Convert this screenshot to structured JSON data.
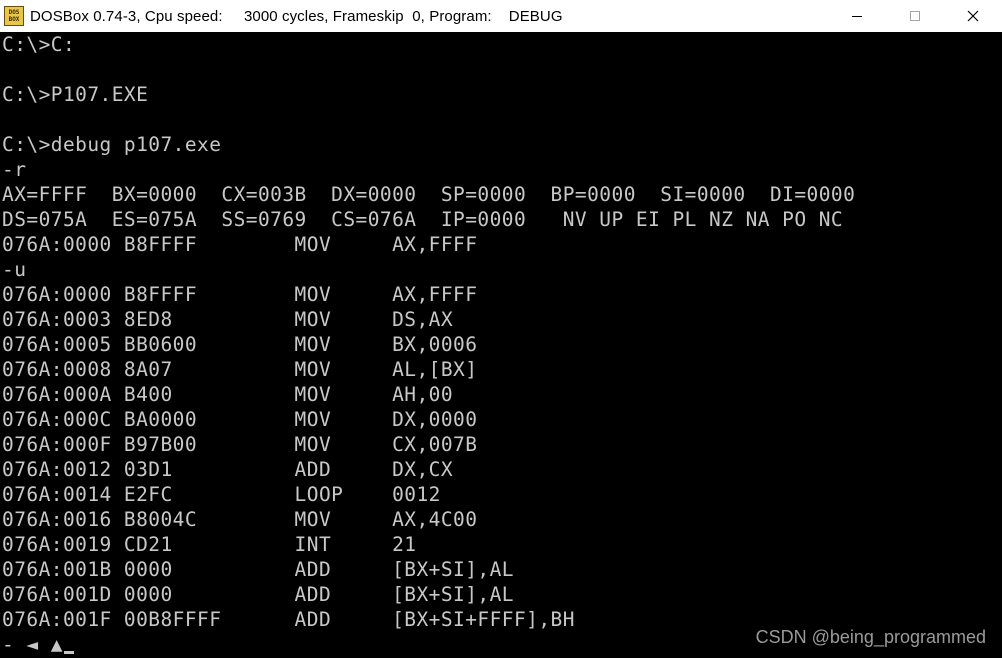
{
  "window": {
    "title": "DOSBox 0.74-3, Cpu speed:     3000 cycles, Frameskip  0, Program:    DEBUG",
    "icon_label_top": "DOS",
    "icon_label_bottom": "BOX",
    "controls": [
      "minimize-icon",
      "maximize-icon",
      "close-icon"
    ]
  },
  "console": {
    "lines": [
      "C:\\>C:",
      "",
      "C:\\>P107.EXE",
      "",
      "C:\\>debug p107.exe",
      "-r",
      "AX=FFFF  BX=0000  CX=003B  DX=0000  SP=0000  BP=0000  SI=0000  DI=0000",
      "DS=075A  ES=075A  SS=0769  CS=076A  IP=0000   NV UP EI PL NZ NA PO NC",
      "076A:0000 B8FFFF        MOV     AX,FFFF",
      "-u",
      "076A:0000 B8FFFF        MOV     AX,FFFF",
      "076A:0003 8ED8          MOV     DS,AX",
      "076A:0005 BB0600        MOV     BX,0006",
      "076A:0008 8A07          MOV     AL,[BX]",
      "076A:000A B400          MOV     AH,00",
      "076A:000C BA0000        MOV     DX,0000",
      "076A:000F B97B00        MOV     CX,007B",
      "076A:0012 03D1          ADD     DX,CX",
      "076A:0014 E2FC          LOOP    0012",
      "076A:0016 B8004C        MOV     AX,4C00",
      "076A:0019 CD21          INT     21",
      "076A:001B 0000          ADD     [BX+SI],AL",
      "076A:001D 0000          ADD     [BX+SI],AL",
      "076A:001F 00B8FFFF      ADD     [BX+SI+FFFF],BH",
      "- ◄ ▲"
    ]
  },
  "watermark": "CSDN @being_programmed",
  "colors": {
    "console_bg": "#000000",
    "console_text": "#c8c8c8",
    "titlebar_bg": "#ffffff"
  }
}
